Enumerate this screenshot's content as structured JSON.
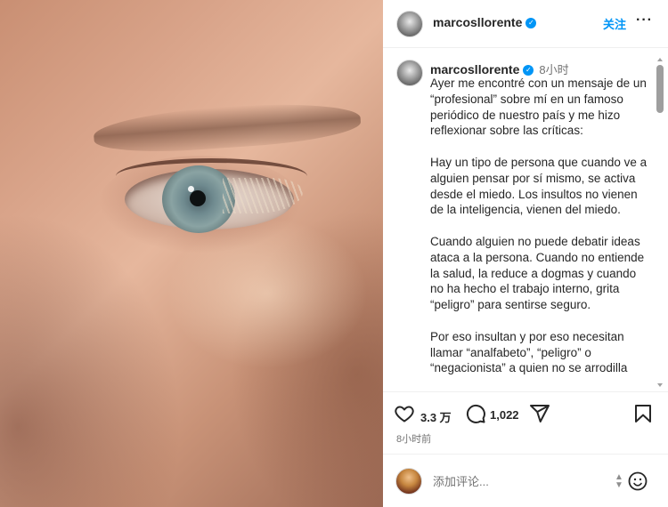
{
  "post": {
    "username": "marcosllorente",
    "follow_label": "关注",
    "more_label": "···",
    "verified_mark": "✓"
  },
  "caption": {
    "username": "marcosllorente",
    "time": "8小时",
    "paragraphs": [
      "Ayer me encontré con un mensaje de un “profesional” sobre mí en un famoso periódico de nuestro país y me hizo reflexionar sobre las críticas:",
      "Hay un tipo de persona que cuando ve a alguien pensar por sí mismo, se activa desde el miedo. Los insultos no vienen de la inteligencia, vienen del miedo.",
      "Cuando alguien no puede debatir ideas ataca a la persona. Cuando no entiende la salud, la reduce a dogmas y cuando no ha hecho el trabajo interno, grita “peligro” para sentirse seguro.",
      "Por eso insultan y por eso necesitan llamar “analfabeto”, “peligro” o “negacionista” a quien no se arrodilla"
    ]
  },
  "actions": {
    "likes": "3.3 万",
    "comments": "1,022",
    "post_time": "8小时前"
  },
  "comment_box": {
    "placeholder": "添加评论..."
  },
  "icons": {
    "like": "heart-icon",
    "comment": "comment-icon",
    "share": "share-icon",
    "save": "bookmark-icon",
    "emoji": "emoji-icon"
  },
  "colors": {
    "accent": "#0095f6",
    "text": "#262626",
    "secondary": "#737373",
    "divider": "#efefef"
  }
}
